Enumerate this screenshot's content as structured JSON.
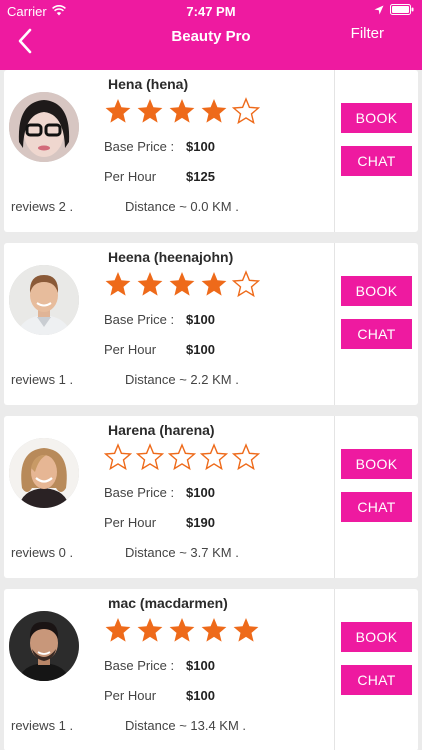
{
  "status_bar": {
    "carrier": "Carrier",
    "wifi_icon": "wifi-icon",
    "time": "7:47 PM",
    "location_icon": "location-arrow-icon",
    "battery_icon": "battery-icon"
  },
  "nav": {
    "back_icon": "chevron-left-icon",
    "title": "Beauty Pro",
    "filter_label": "Filter"
  },
  "colors": {
    "accent": "#ee1aa0",
    "star": "#ee6a1a"
  },
  "providers": [
    {
      "name": "Hena (hena)",
      "rating": 4,
      "max_rating": 5,
      "base_price_label": "Base Price :",
      "base_price": "$100",
      "per_hour_label": "Per Hour",
      "per_hour": "$125",
      "reviews": "reviews 2 .",
      "distance": "Distance ~ 0.0 KM .",
      "book_label": "BOOK",
      "chat_label": "CHAT"
    },
    {
      "name": "Heena (heenajohn)",
      "rating": 4,
      "max_rating": 5,
      "base_price_label": "Base Price :",
      "base_price": "$100",
      "per_hour_label": "Per Hour",
      "per_hour": "$100",
      "reviews": "reviews 1 .",
      "distance": "Distance ~ 2.2 KM .",
      "book_label": "BOOK",
      "chat_label": "CHAT"
    },
    {
      "name": "Harena (harena)",
      "rating": 0,
      "max_rating": 5,
      "base_price_label": "Base Price :",
      "base_price": "$100",
      "per_hour_label": "Per Hour",
      "per_hour": "$190",
      "reviews": "reviews 0 .",
      "distance": "Distance ~ 3.7 KM .",
      "book_label": "BOOK",
      "chat_label": "CHAT"
    },
    {
      "name": "mac (macdarmen)",
      "rating": 5,
      "max_rating": 5,
      "base_price_label": "Base Price :",
      "base_price": "$100",
      "per_hour_label": "Per Hour",
      "per_hour": "$100",
      "reviews": "reviews 1 .",
      "distance": "Distance ~ 13.4 KM .",
      "book_label": "BOOK",
      "chat_label": "CHAT"
    }
  ]
}
